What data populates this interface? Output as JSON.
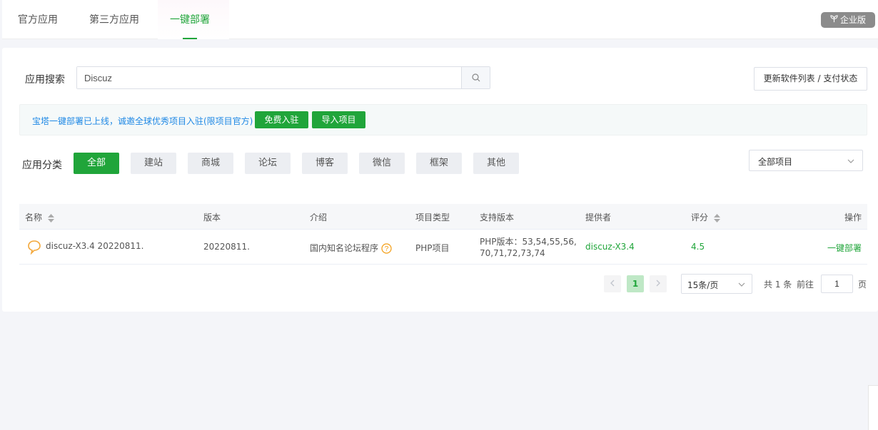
{
  "tabs": [
    {
      "label": "官方应用"
    },
    {
      "label": "第三方应用"
    },
    {
      "label": "一键部署"
    }
  ],
  "enterprise_badge": "企业版",
  "search": {
    "label": "应用搜索",
    "value": "Discuz"
  },
  "refresh_button": "更新软件列表 / 支付状态",
  "notice": {
    "text": "宝塔一键部署已上线，诚邀全球优秀项目入驻(限项目官方)",
    "btn_free": "免费入驻",
    "btn_import": "导入项目"
  },
  "category": {
    "label": "应用分类",
    "items": [
      "全部",
      "建站",
      "商城",
      "论坛",
      "博客",
      "微信",
      "框架",
      "其他"
    ],
    "selected": "全部"
  },
  "project_filter": "全部项目",
  "table": {
    "headers": [
      "名称",
      "版本",
      "介绍",
      "项目类型",
      "支持版本",
      "提供者",
      "评分",
      "操作"
    ],
    "rows": [
      {
        "name": "discuz-X3.4 20220811.",
        "version": "20220811.",
        "intro": "国内知名论坛程序",
        "type": "PHP项目",
        "support_line1": "PHP版本：53,54,55,56,",
        "support_line2": "70,71,72,73,74",
        "provider": "discuz-X3.4",
        "score": "4.5",
        "action": "一键部署"
      }
    ]
  },
  "pagination": {
    "current": "1",
    "page_size": "15条/页",
    "total": "共 1 条",
    "goto_label": "前往",
    "goto_value": "1",
    "page_suffix": "页"
  },
  "colors": {
    "accent": "#20a53a",
    "link_blue": "#1e88e5"
  }
}
